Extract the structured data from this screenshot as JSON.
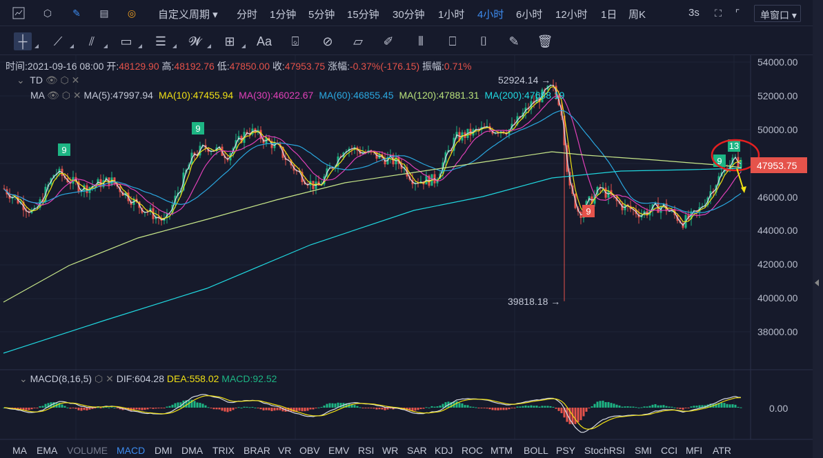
{
  "toolbar": {
    "custom_period": "自定义周期",
    "periods": [
      "分时",
      "1分钟",
      "5分钟",
      "15分钟",
      "30分钟",
      "1小时",
      "4小时",
      "6小时",
      "12小时",
      "1日",
      "周K"
    ],
    "active_period": "4小时",
    "refresh": "3s",
    "window_mode": "单窗口"
  },
  "drawing_tools": [
    "crosshair",
    "trend-line",
    "parallel-channel",
    "rectangle",
    "fib-retracement",
    "wave",
    "measure",
    "text",
    "ruler-1",
    "ruler-2",
    "ruler-3",
    "brush",
    "candles",
    "lock",
    "bookmark",
    "note",
    "trash"
  ],
  "ohlc": {
    "time_label": "时间:",
    "time": "2021-09-16 08:00",
    "open_label": "开:",
    "open": "48129.90",
    "high_label": "高:",
    "high": "48192.76",
    "low_label": "低:",
    "low": "47850.00",
    "close_label": "收:",
    "close": "47953.75",
    "change_label": "涨幅:",
    "change": "-0.37%(-176.15)",
    "amp_label": "振幅:",
    "amp": "0.71%"
  },
  "indicators": {
    "td": "TD",
    "ma": "MA",
    "ma_values": [
      {
        "label": "MA(5):47997.94",
        "color": "#c5cad8"
      },
      {
        "label": "MA(10):47455.94",
        "color": "#f0e014"
      },
      {
        "label": "MA(30):46022.67",
        "color": "#e040b8"
      },
      {
        "label": "MA(60):46855.45",
        "color": "#2aa8e0"
      },
      {
        "label": "MA(120):47881.31",
        "color": "#b8e07a"
      },
      {
        "label": "MA(200):47688.19",
        "color": "#20d8e0"
      }
    ]
  },
  "price_axis": [
    "54000.00",
    "52000.00",
    "50000.00",
    "48000.00",
    "46000.00",
    "44000.00",
    "42000.00",
    "40000.00",
    "38000.00"
  ],
  "annotations": {
    "high": "52924.14 →",
    "low": "39818.18 →",
    "last_price": "47953.75",
    "td_marks": [
      "9",
      "9",
      "9",
      "13",
      "9"
    ]
  },
  "macd": {
    "title": "MACD(8,16,5)",
    "dif": "DIF:604.28",
    "dea": "DEA:558.02",
    "macd": "MACD:92.52",
    "zero": "0.00"
  },
  "bottom_tabs": [
    "MA",
    "EMA",
    "VOLUME",
    "MACD",
    "DMI",
    "DMA",
    "TRIX",
    "BRAR",
    "VR",
    "OBV",
    "EMV",
    "RSI",
    "WR",
    "SAR",
    "KDJ",
    "ROC",
    "MTM",
    "BOLL",
    "PSY",
    "StochRSI",
    "SMI",
    "CCI",
    "MFI",
    "ATR"
  ],
  "active_tab": "MACD",
  "colors": {
    "up": "#1db584",
    "down": "#e5534b",
    "accent": "#3d8cf0"
  }
}
